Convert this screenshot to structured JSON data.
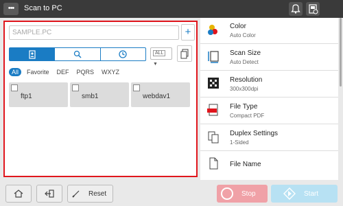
{
  "topbar": {
    "title": "Scan to PC",
    "menu_icon": "ellipsis-icon",
    "icons": [
      "bell-icon",
      "device-icon"
    ]
  },
  "left": {
    "search_placeholder": "SAMPLE.PC",
    "add_label": "+",
    "tabs": [
      "address-book-icon",
      "search-icon",
      "history-icon"
    ],
    "active_tab": 0,
    "all_select": "ALL",
    "filters": [
      "All",
      "Favorite",
      "DEF",
      "PQRS",
      "WXYZ"
    ],
    "active_filter": "All",
    "destinations": [
      "ftp1",
      "smb1",
      "webdav1"
    ]
  },
  "right": {
    "settings": [
      {
        "title": "Color",
        "value": "Auto Color",
        "icon": "color-icon"
      },
      {
        "title": "Scan Size",
        "value": "Auto Detect",
        "icon": "scan-size-icon"
      },
      {
        "title": "Resolution",
        "value": "300x300dpi",
        "icon": "resolution-icon"
      },
      {
        "title": "File Type",
        "value": "Compact PDF",
        "icon": "pdf-icon"
      },
      {
        "title": "Duplex Settings",
        "value": "1-Sided",
        "icon": "duplex-icon"
      },
      {
        "title": "File Name",
        "value": "",
        "icon": "file-icon"
      }
    ]
  },
  "bottom": {
    "reset_label": "Reset",
    "stop_label": "Stop",
    "start_label": "Start"
  },
  "colors": {
    "accent": "#1a7cc4",
    "highlight": "#e0151c",
    "stop": "#f0a1a7",
    "start": "#b7e1f3"
  }
}
